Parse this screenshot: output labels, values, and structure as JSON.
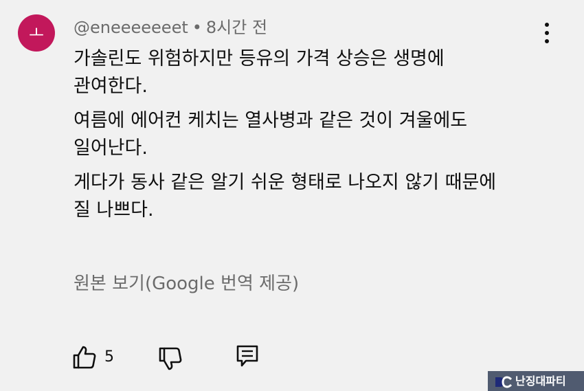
{
  "comment": {
    "avatar_letter": "ㅗ",
    "author": "@eneeeeeeet",
    "separator": "•",
    "timestamp": "8시간 전",
    "lines": [
      "가솔린도 위험하지만 등유의 가격 상승은 생명에",
      "관여한다.",
      "여름에 에어컨 케치는 열사병과 같은 것이 겨울에도",
      "일어난다.",
      "게다가 동사 같은 알기 쉬운 형태로 나오지 않기 때문에",
      "질 나쁘다."
    ],
    "translate_link": "원본 보기(Google 번역 제공)",
    "like_count": "5"
  },
  "watermark": {
    "text": "난징대파티"
  },
  "colors": {
    "background": "#f1f1f1",
    "avatar": "#c2185b",
    "secondary_text": "#6b6b6b",
    "primary_text": "#0f0f0f",
    "watermark_bg": "#505b70"
  },
  "icons": {
    "menu": "more-vertical-icon",
    "like": "thumbs-up-icon",
    "dislike": "thumbs-down-icon",
    "reply": "reply-comment-icon",
    "watermark_logo": "dc-logo-icon"
  }
}
